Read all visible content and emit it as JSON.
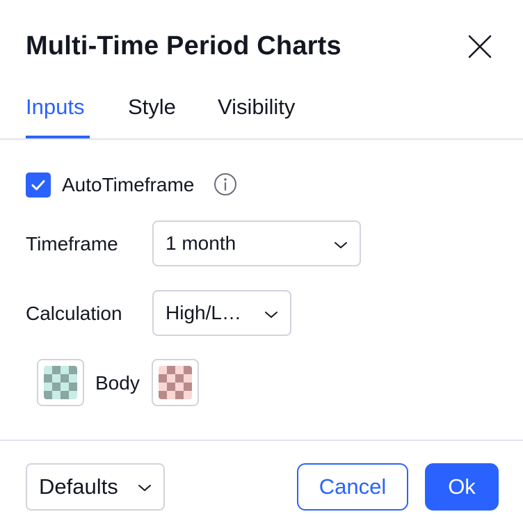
{
  "dialog": {
    "title": "Multi-Time Period Charts"
  },
  "tabs": [
    {
      "label": "Inputs",
      "active": true
    },
    {
      "label": "Style",
      "active": false
    },
    {
      "label": "Visibility",
      "active": false
    }
  ],
  "inputs": {
    "auto_timeframe": {
      "label": "AutoTimeframe",
      "checked": true
    },
    "timeframe": {
      "label": "Timeframe",
      "value": "1 month"
    },
    "calculation": {
      "label": "Calculation",
      "value": "High/L…"
    },
    "body": {
      "label": "Body"
    }
  },
  "footer": {
    "defaults_label": "Defaults",
    "cancel_label": "Cancel",
    "ok_label": "Ok"
  },
  "colors": {
    "accent": "#2962ff",
    "border": "#d1d4dc",
    "divider": "#e0e3eb",
    "text": "#131722",
    "body_up_swatch": "#8aa7a1",
    "body_down_swatch": "#b88b8a"
  },
  "icons": {
    "close": "close-icon",
    "info": "info-icon",
    "check": "check-icon",
    "chevron": "chevron-down-icon"
  }
}
